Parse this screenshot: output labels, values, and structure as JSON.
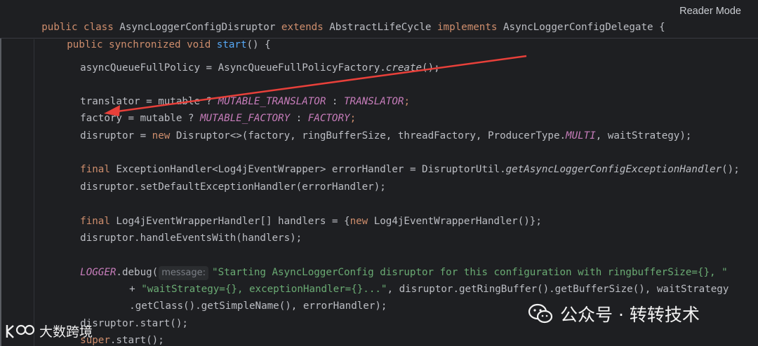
{
  "reader_mode": "Reader Mode",
  "colors": {
    "background": "#1e1f22",
    "keyword": "#cf8e6d",
    "method": "#56a8f5",
    "static_constant": "#c77dbb",
    "string": "#6aab73",
    "default_text": "#bcbec4",
    "annotation_arrow": "#e8403a"
  },
  "code": {
    "class_header": {
      "kw1": "public class ",
      "name": "AsyncLoggerConfigDisruptor ",
      "kw2": "extends ",
      "parent": "AbstractLifeCycle ",
      "kw3": "implements ",
      "iface": "AsyncLoggerConfigDelegate {"
    },
    "method_header": {
      "kw": "public synchronized void ",
      "name": "start",
      "rest": "() {"
    },
    "l1": {
      "a": "asyncQueueFullPolicy = AsyncQueueFullPolicyFactory.",
      "b": "create",
      "c": "();"
    },
    "l2": {
      "a": "translator = mutable ? ",
      "b": "MUTABLE_TRANSLATOR",
      "c": " : ",
      "d": "TRANSLATOR",
      "e": ";"
    },
    "l3": {
      "a": "factory = mutable ? ",
      "b": "MUTABLE_FACTORY",
      "c": " : ",
      "d": "FACTORY",
      "e": ";"
    },
    "l4": {
      "a": "disruptor = ",
      "kw": "new",
      "b": " Disruptor<>(factory, ringBufferSize, threadFactory, ProducerType.",
      "c": "MULTI",
      "d": ", waitStrategy);"
    },
    "l5": {
      "kw": "final",
      "a": " ExceptionHandler<Log4jEventWrapper> errorHandler = DisruptorUtil.",
      "b": "getAsyncLoggerConfigExceptionHandler",
      "c": "();"
    },
    "l6": {
      "a": "disruptor.setDefaultExceptionHandler(errorHandler);"
    },
    "l7": {
      "kw": "final",
      "a": " Log4jEventWrapperHandler[] handlers = {",
      "kw2": "new",
      "b": " Log4jEventWrapperHandler()};"
    },
    "l8": {
      "a": "disruptor.handleEventsWith(handlers);"
    },
    "l9": {
      "a": "LOGGER",
      "b": ".debug(",
      "hint": "message:",
      "s": "\"Starting AsyncLoggerConfig disruptor for this configuration with ringbufferSize={}, \""
    },
    "l10": {
      "a": "+ ",
      "s": "\"waitStrategy={}, exceptionHandler={}...\"",
      "b": ", disruptor.getRingBuffer().getBufferSize(), waitStrategy"
    },
    "l11": {
      "a": ".getClass().getSimpleName(), errorHandler);"
    },
    "l12": {
      "a": "disruptor.start();"
    },
    "l13": {
      "kw": "super",
      "a": ".start();"
    },
    "l14": {
      "a": "}"
    }
  },
  "watermark_wechat": "公众号 · 转转技术",
  "watermark_brand": "大数跨境"
}
